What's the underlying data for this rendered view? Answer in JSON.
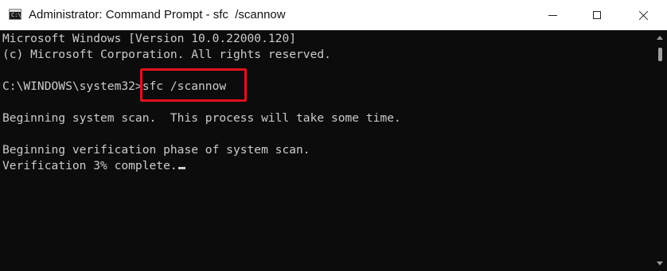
{
  "window": {
    "title": "Administrator: Command Prompt - sfc  /scannow",
    "app_icon": "command-prompt-icon",
    "app_icon_glyph": "C:\\.",
    "controls": [
      "minimize-icon",
      "maximize-icon",
      "close-icon"
    ]
  },
  "console": {
    "line1": "Microsoft Windows [Version 10.0.22000.120]",
    "line2": "(c) Microsoft Corporation. All rights reserved.",
    "prompt_path": "C:\\WINDOWS\\system32>",
    "command": "sfc /scannow",
    "line4": "Beginning system scan.  This process will take some time.",
    "line5": "Beginning verification phase of system scan.",
    "line6": "Verification 3% complete."
  },
  "colors": {
    "console_background": "#0c0c0c",
    "console_text": "#cccccc",
    "titlebar_background": "#ffffff",
    "highlight_box": "#e3101d"
  }
}
